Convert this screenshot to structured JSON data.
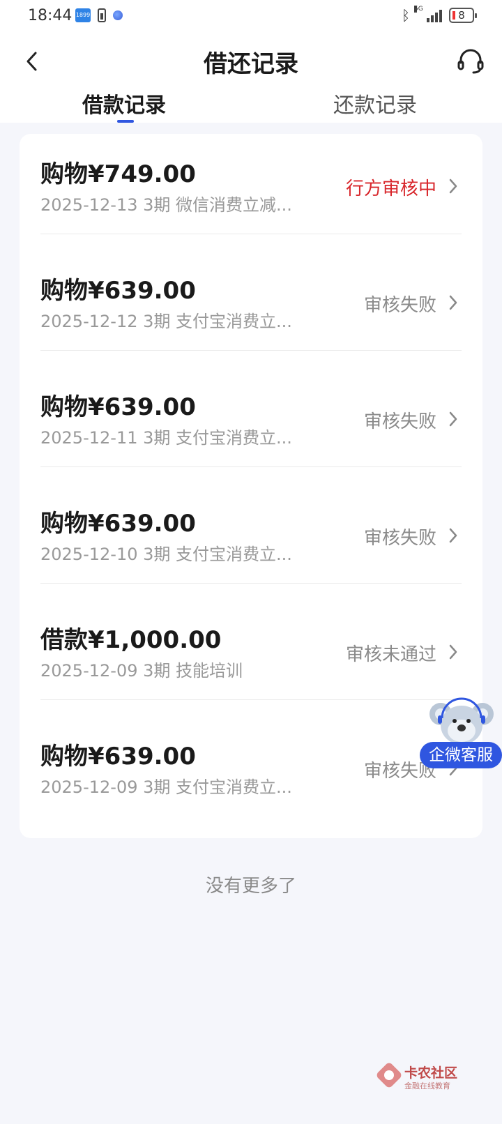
{
  "status_bar": {
    "time": "18:44",
    "badge": "1899",
    "network": "5G",
    "battery": "8"
  },
  "header": {
    "title": "借还记录"
  },
  "tabs": [
    {
      "label": "借款记录",
      "active": true
    },
    {
      "label": "还款记录",
      "active": false
    }
  ],
  "records": [
    {
      "amount": "购物¥749.00",
      "detail": "2025-12-13 3期  微信消费立减...",
      "status": "行方审核中",
      "status_color": "#d8262b"
    },
    {
      "amount": "购物¥639.00",
      "detail": "2025-12-12 3期  支付宝消费立...",
      "status": "审核失败",
      "status_color": "#8a8a8a"
    },
    {
      "amount": "购物¥639.00",
      "detail": "2025-12-11 3期  支付宝消费立...",
      "status": "审核失败",
      "status_color": "#8a8a8a"
    },
    {
      "amount": "购物¥639.00",
      "detail": "2025-12-10 3期  支付宝消费立...",
      "status": "审核失败",
      "status_color": "#8a8a8a"
    },
    {
      "amount": "借款¥1,000.00",
      "detail": "2025-12-09 3期  技能培训",
      "status": "审核未通过",
      "status_color": "#8a8a8a"
    },
    {
      "amount": "购物¥639.00",
      "detail": "2025-12-09 3期  支付宝消费立...",
      "status": "审核失败",
      "status_color": "#8a8a8a"
    }
  ],
  "floating_service": {
    "label": "企微客服"
  },
  "footer": {
    "no_more": "没有更多了"
  },
  "watermark": {
    "title": "卡农社区",
    "subtitle": "金融在线教育"
  },
  "colors": {
    "accent": "#2f56e0",
    "pending": "#d8262b",
    "background": "#f5f6fb"
  }
}
